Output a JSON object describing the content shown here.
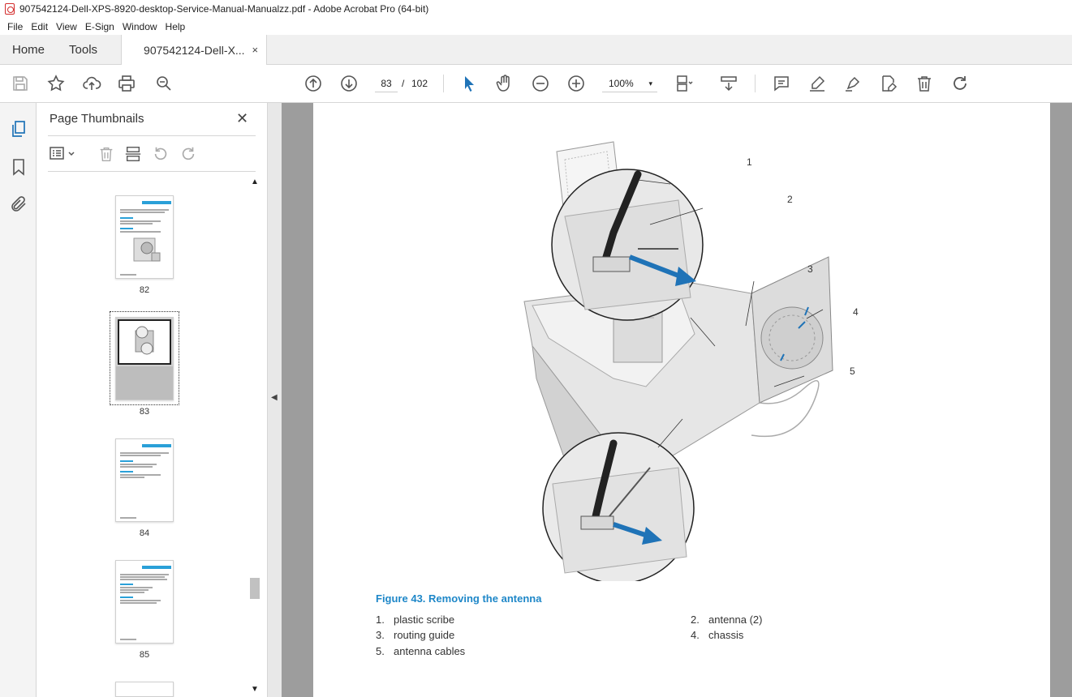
{
  "window": {
    "title": "907542124-Dell-XPS-8920-desktop-Service-Manual-Manualzz.pdf - Adobe Acrobat Pro (64-bit)"
  },
  "menu": [
    "File",
    "Edit",
    "View",
    "E-Sign",
    "Window",
    "Help"
  ],
  "tabs": {
    "home": "Home",
    "tools": "Tools",
    "document": "907542124-Dell-X...",
    "close": "×"
  },
  "toolbar": {
    "current_page": "83",
    "separator": "/",
    "total_pages": "102",
    "zoom": "100%",
    "zoom_caret": "▾"
  },
  "thumbnails_panel": {
    "title": "Page Thumbnails",
    "close": "✕",
    "pages": [
      {
        "label": "82"
      },
      {
        "label": "83",
        "selected": true
      },
      {
        "label": "84"
      },
      {
        "label": "85"
      }
    ]
  },
  "collapse_arrow": "◀",
  "figure": {
    "caption": "Figure 43. Removing the antenna",
    "callouts": [
      "1",
      "2",
      "3",
      "4",
      "5"
    ],
    "legend": [
      {
        "num": "1.",
        "text": "plastic scribe"
      },
      {
        "num": "2.",
        "text": "antenna (2)"
      },
      {
        "num": "3.",
        "text": "routing guide"
      },
      {
        "num": "4.",
        "text": "chassis"
      },
      {
        "num": "5.",
        "text": "antenna cables"
      }
    ]
  },
  "scroll": {
    "up": "▲",
    "down": "▼"
  },
  "colors": {
    "accent": "#1e87c8",
    "arrow_blue": "#1f73b7",
    "pdf_red": "#d32b2b",
    "doc_bg": "#9d9d9d"
  }
}
